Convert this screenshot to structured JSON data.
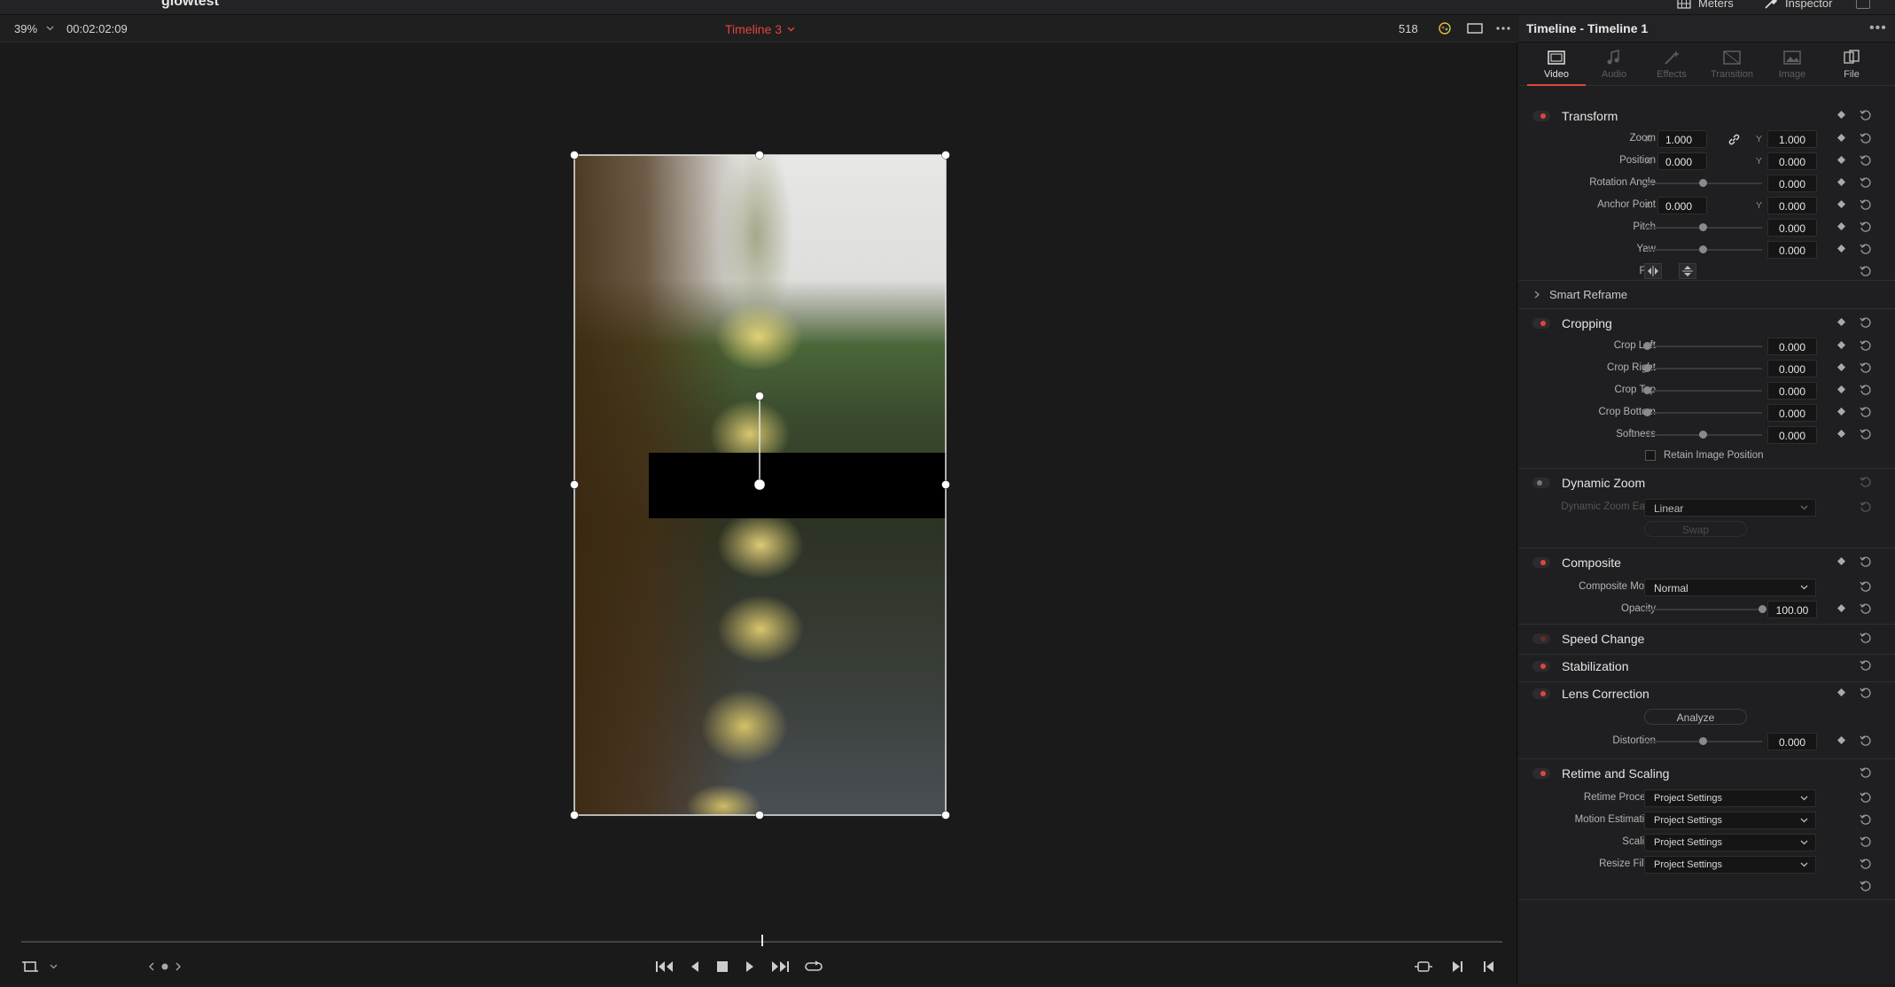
{
  "app": {
    "project_title": "glowtest",
    "top_tabs": {
      "meters": "Meters",
      "inspector": "Inspector"
    }
  },
  "viewer": {
    "zoom_level": "39%",
    "timecode": "00:02:02:09",
    "timeline_name": "Timeline 3",
    "frame_count": "518",
    "scrub_position": 0.5
  },
  "inspector": {
    "title": "Timeline - Timeline 1",
    "tabs": [
      {
        "label": "Video",
        "active": true
      },
      {
        "label": "Audio",
        "active": false
      },
      {
        "label": "Effects",
        "active": false
      },
      {
        "label": "Transition",
        "active": false
      },
      {
        "label": "Image",
        "active": false
      },
      {
        "label": "File",
        "active": false
      }
    ],
    "transform": {
      "title": "Transform",
      "zoom": {
        "label": "Zoom",
        "x_axis": "X",
        "x": "1.000",
        "y_axis": "Y",
        "y": "1.000"
      },
      "position": {
        "label": "Position",
        "x_axis": "X",
        "x": "0.000",
        "y_axis": "Y",
        "y": "0.000"
      },
      "rotation": {
        "label": "Rotation Angle",
        "value": "0.000"
      },
      "anchor": {
        "label": "Anchor Point",
        "x_axis": "X",
        "x": "0.000",
        "y_axis": "Y",
        "y": "0.000"
      },
      "pitch": {
        "label": "Pitch",
        "value": "0.000"
      },
      "yaw": {
        "label": "Yaw",
        "value": "0.000"
      },
      "flip": {
        "label": "Flip"
      }
    },
    "smart_reframe": {
      "title": "Smart Reframe"
    },
    "cropping": {
      "title": "Cropping",
      "crop_left": {
        "label": "Crop Left",
        "value": "0.000"
      },
      "crop_right": {
        "label": "Crop Right",
        "value": "0.000"
      },
      "crop_top": {
        "label": "Crop Top",
        "value": "0.000"
      },
      "crop_bottom": {
        "label": "Crop Bottom",
        "value": "0.000"
      },
      "softness": {
        "label": "Softness",
        "value": "0.000"
      },
      "retain_label": "Retain Image Position"
    },
    "dynamic_zoom": {
      "title": "Dynamic Zoom",
      "ease_label": "Dynamic Zoom Ease",
      "ease_value": "Linear",
      "swap_label": "Swap"
    },
    "composite": {
      "title": "Composite",
      "mode_label": "Composite Mode",
      "mode_value": "Normal",
      "opacity_label": "Opacity",
      "opacity_value": "100.00"
    },
    "speed_change": {
      "title": "Speed Change"
    },
    "stabilization": {
      "title": "Stabilization"
    },
    "lens_correction": {
      "title": "Lens Correction",
      "analyze_label": "Analyze",
      "distortion_label": "Distortion",
      "distortion_value": "0.000"
    },
    "retime_scaling": {
      "title": "Retime and Scaling",
      "retime_process": {
        "label": "Retime Process",
        "value": "Project Settings"
      },
      "motion_estimation": {
        "label": "Motion Estimation",
        "value": "Project Settings"
      },
      "scaling": {
        "label": "Scaling",
        "value": "Project Settings"
      },
      "resize_filter": {
        "label": "Resize Filter",
        "value": "Project Settings"
      }
    }
  },
  "colors": {
    "accent_red": "#e0453e",
    "panel_bg": "#1f1f21",
    "viewer_bg": "#1a1a1a"
  }
}
